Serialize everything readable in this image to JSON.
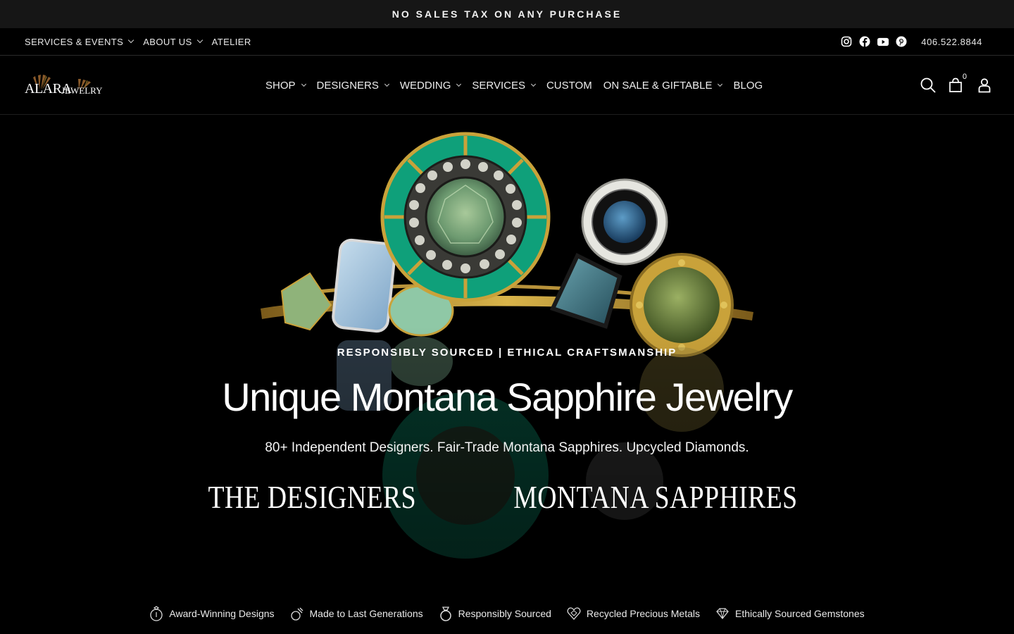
{
  "announcement": "NO SALES TAX ON ANY PURCHASE",
  "utility": {
    "left_items": [
      {
        "label": "SERVICES & EVENTS",
        "dropdown": true
      },
      {
        "label": "ABOUT US",
        "dropdown": true
      },
      {
        "label": "ATELIER",
        "dropdown": false
      }
    ],
    "social_icons": [
      "instagram-icon",
      "facebook-icon",
      "youtube-icon",
      "pinterest-icon"
    ],
    "phone": "406.522.8844"
  },
  "brand": {
    "name_main": "ALARA",
    "name_sub": "JEWELRY"
  },
  "nav": {
    "items": [
      {
        "label": "SHOP",
        "dropdown": true
      },
      {
        "label": "DESIGNERS",
        "dropdown": true
      },
      {
        "label": "WEDDING",
        "dropdown": true
      },
      {
        "label": "SERVICES",
        "dropdown": true
      },
      {
        "label": "CUSTOM",
        "dropdown": false
      },
      {
        "label": "ON SALE & GIFTABLE",
        "dropdown": true
      },
      {
        "label": "BLOG",
        "dropdown": false
      }
    ],
    "cart_count": "0",
    "icons": [
      "search-icon",
      "cart-icon",
      "account-icon"
    ]
  },
  "hero": {
    "eyebrow": "RESPONSIBLY SOURCED | ETHICAL CRAFTSMANSHIP",
    "headline": "Unique Montana Sapphire Jewelry",
    "subheadline": "80+ Independent Designers. Fair-Trade Montana Sapphires. Upcycled Diamonds.",
    "links": [
      "THE DESIGNERS",
      "MONTANA SAPPHIRES"
    ]
  },
  "features": [
    {
      "icon": "award-ring-icon",
      "label": "Award-Winning Designs"
    },
    {
      "icon": "hammer-ring-icon",
      "label": "Made to Last Generations"
    },
    {
      "icon": "solitaire-ring-icon",
      "label": "Responsibly Sourced"
    },
    {
      "icon": "recycled-heart-icon",
      "label": "Recycled Precious Metals"
    },
    {
      "icon": "diamond-icon",
      "label": "Ethically Sourced Gemstones"
    }
  ],
  "colors": {
    "background": "#000000",
    "announcement_bg": "#161616",
    "enamel_green": "#0fa07a",
    "gold": "#c9a23a",
    "sapphire_blue": "#2e5e85"
  }
}
